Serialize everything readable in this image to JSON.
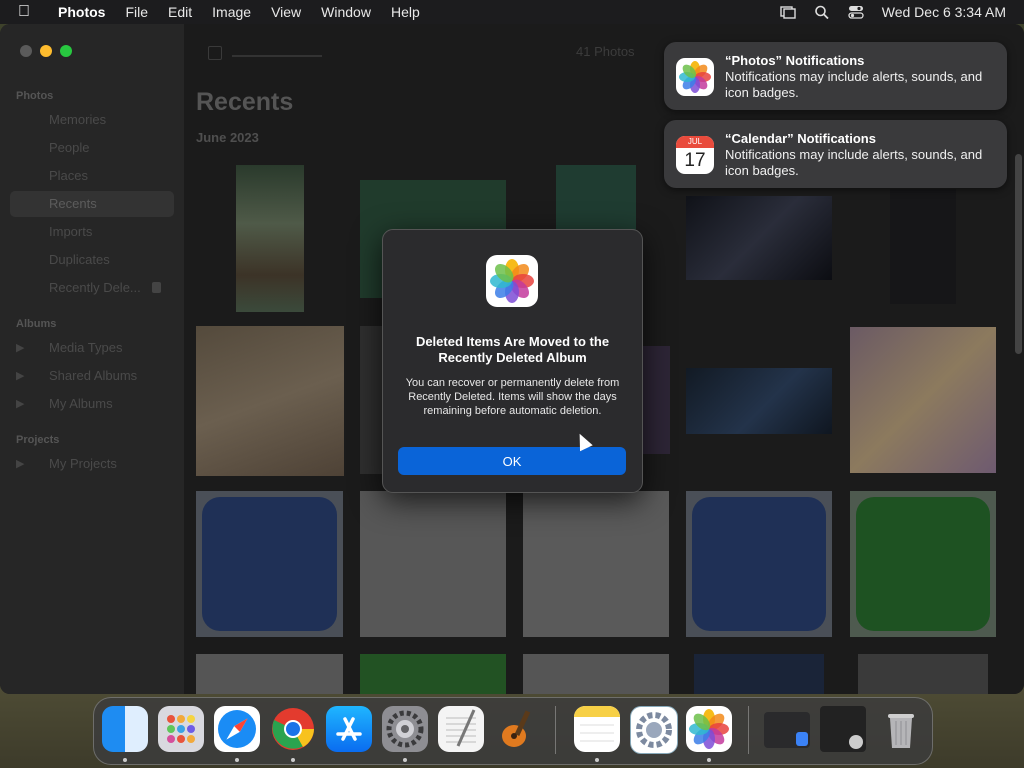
{
  "menubar": {
    "app": "Photos",
    "items": [
      "File",
      "Edit",
      "Image",
      "View",
      "Window",
      "Help"
    ],
    "clock": "Wed Dec 6  3:34 AM"
  },
  "sidebar": {
    "section_photos": "Photos",
    "items_photos": [
      "Memories",
      "People",
      "Places",
      "Recents",
      "Imports",
      "Duplicates",
      "Recently Dele..."
    ],
    "section_albums": "Albums",
    "items_albums": [
      "Media Types",
      "Shared Albums",
      "My Albums"
    ],
    "section_projects": "Projects",
    "items_projects": [
      "My Projects"
    ]
  },
  "main": {
    "photo_count": "41 Photos",
    "title": "Recents",
    "subtitle": "June 2023"
  },
  "notifications": [
    {
      "title": "“Photos” Notifications",
      "body": "Notifications may include alerts, sounds, and icon badges."
    },
    {
      "title": "“Calendar” Notifications",
      "body": "Notifications may include alerts, sounds, and icon badges.",
      "cal_month": "JUL",
      "cal_day": "17"
    }
  ],
  "dialog": {
    "title": "Deleted Items Are Moved to the Recently Deleted Album",
    "body": "You can recover or permanently delete from Recently Deleted. Items will show the days remaining before automatic deletion.",
    "ok_label": "OK"
  },
  "dock": {
    "apps": [
      "finder-icon",
      "launchpad-icon",
      "safari-icon",
      "chrome-icon",
      "app-store-icon",
      "system-settings-icon",
      "textedit-icon",
      "garageband-icon",
      "notes-icon",
      "settings-icon",
      "photos-icon",
      "preview-window-icon",
      "screenshot-window-icon",
      "trash-icon"
    ]
  },
  "colors": {
    "accent": "#0a64d8",
    "close": "#ff5f57",
    "minimize": "#febc2e",
    "zoom": "#28c840"
  }
}
